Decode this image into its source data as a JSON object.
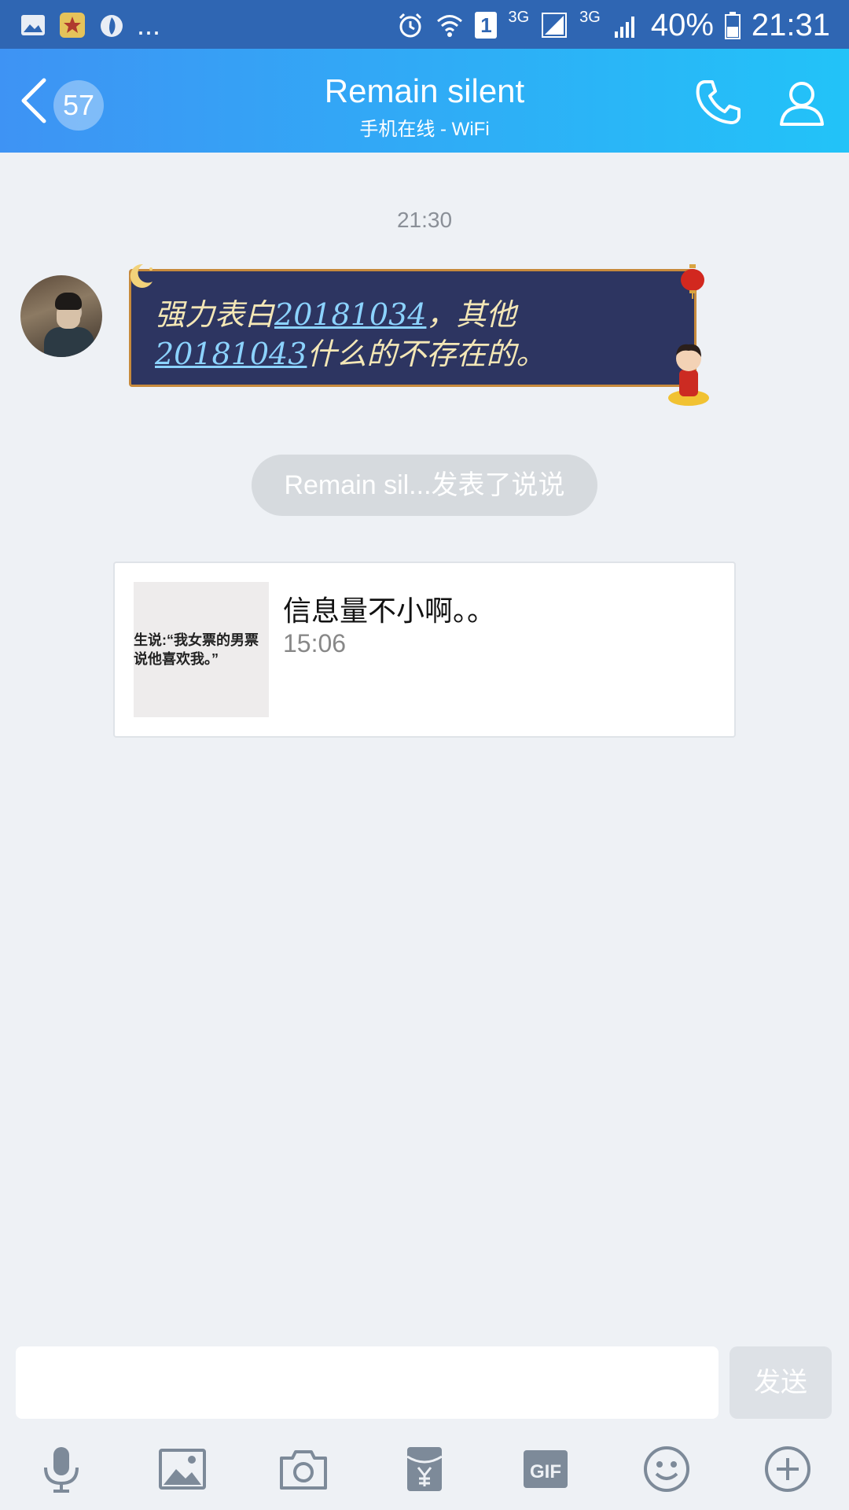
{
  "status_bar": {
    "dots": "...",
    "sim_label_1": "3G",
    "sim_label_2": "3G",
    "sim_slot": "1",
    "battery": "40%",
    "time": "21:31",
    "icons": [
      "image-icon",
      "star-app-icon",
      "flame-icon",
      "alarm-icon",
      "wifi-icon",
      "signal-icon",
      "battery-icon"
    ]
  },
  "header": {
    "unread_count": "57",
    "title": "Remain silent",
    "subtitle": "手机在线 - WiFi",
    "colors": {
      "gradient_start": "#3e93f4",
      "gradient_end": "#22c3f8"
    }
  },
  "chat": {
    "timestamp": "21:30",
    "message": {
      "text_1": "强力表白",
      "link_1": "20181034",
      "text_2": "，其他",
      "link_2": "20181043",
      "text_3": "什么的不存在的。"
    },
    "system_notice": "Remain sil...发表了说说",
    "share_card": {
      "thumb_text": "生说:“我女票的男票\n说他喜欢我。”",
      "title": "信息量不小啊。。",
      "time": "15:06"
    }
  },
  "composer": {
    "input_value": "",
    "send_label": "发送",
    "toolbar_icons": [
      "microphone-icon",
      "picture-icon",
      "camera-icon",
      "red-packet-icon",
      "gif-icon",
      "emoji-icon",
      "plus-icon"
    ],
    "gif_label": "GIF"
  }
}
